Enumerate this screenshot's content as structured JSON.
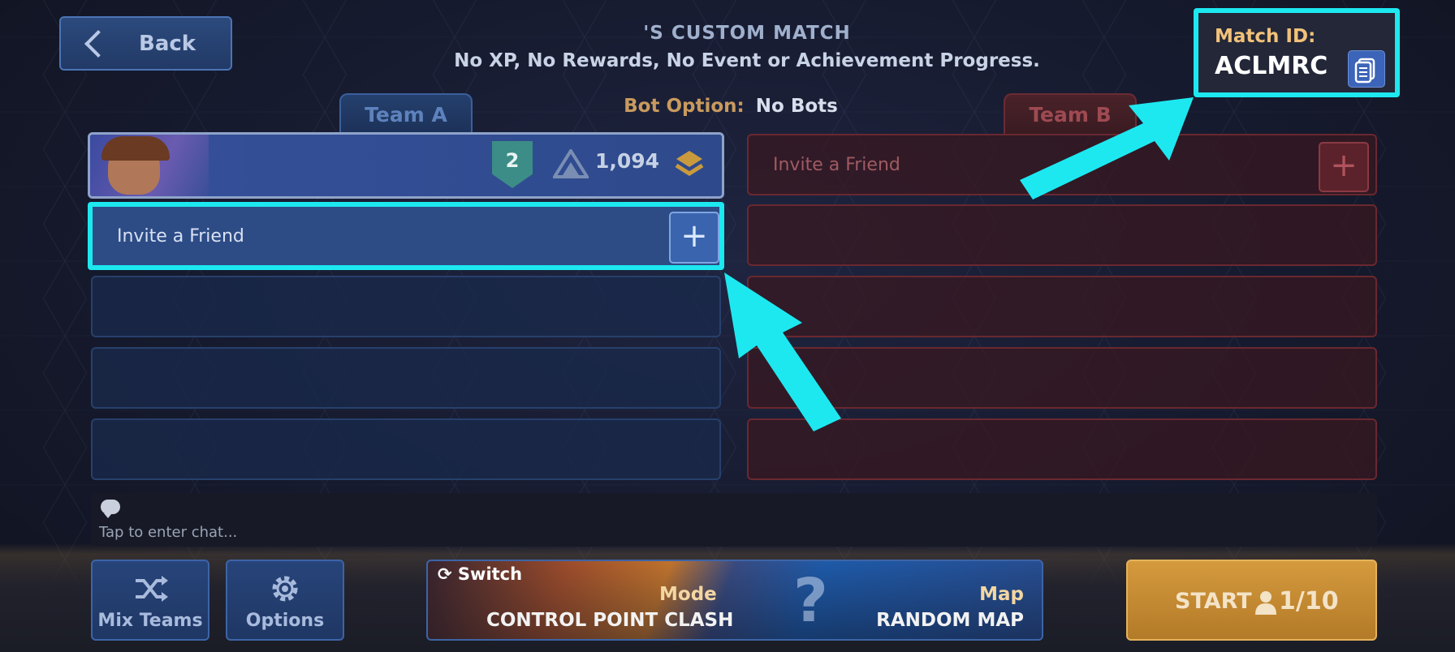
{
  "header": {
    "back_label": "Back",
    "title": "'S CUSTOM MATCH",
    "subtitle": "No XP, No Rewards, No Event or Achievement Progress."
  },
  "bot_option": {
    "label": "Bot Option:",
    "value": "No Bots"
  },
  "match_id": {
    "label": "Match ID:",
    "value": "ACLMRC",
    "copy_icon": "copy-icon"
  },
  "team_a": {
    "tab_label": "Team A",
    "player": {
      "rank": "2",
      "rating": "1,094"
    },
    "invite_label": "Invite a Friend"
  },
  "team_b": {
    "tab_label": "Team B",
    "invite_label": "Invite a Friend"
  },
  "chat": {
    "placeholder": "Tap to enter chat..."
  },
  "bottom": {
    "mix_teams": "Mix Teams",
    "options": "Options",
    "switch": "Switch",
    "mode_label": "Mode",
    "mode_value": "CONTROL POINT CLASH",
    "map_label": "Map",
    "map_value": "RANDOM MAP",
    "start_label": "START",
    "player_count": "1/10"
  },
  "colors": {
    "highlight": "#1de8f0",
    "team_a": "#2d4c86",
    "team_b": "#5b222b",
    "start": "#d59a3d",
    "match_id_label": "#f2c27a"
  }
}
